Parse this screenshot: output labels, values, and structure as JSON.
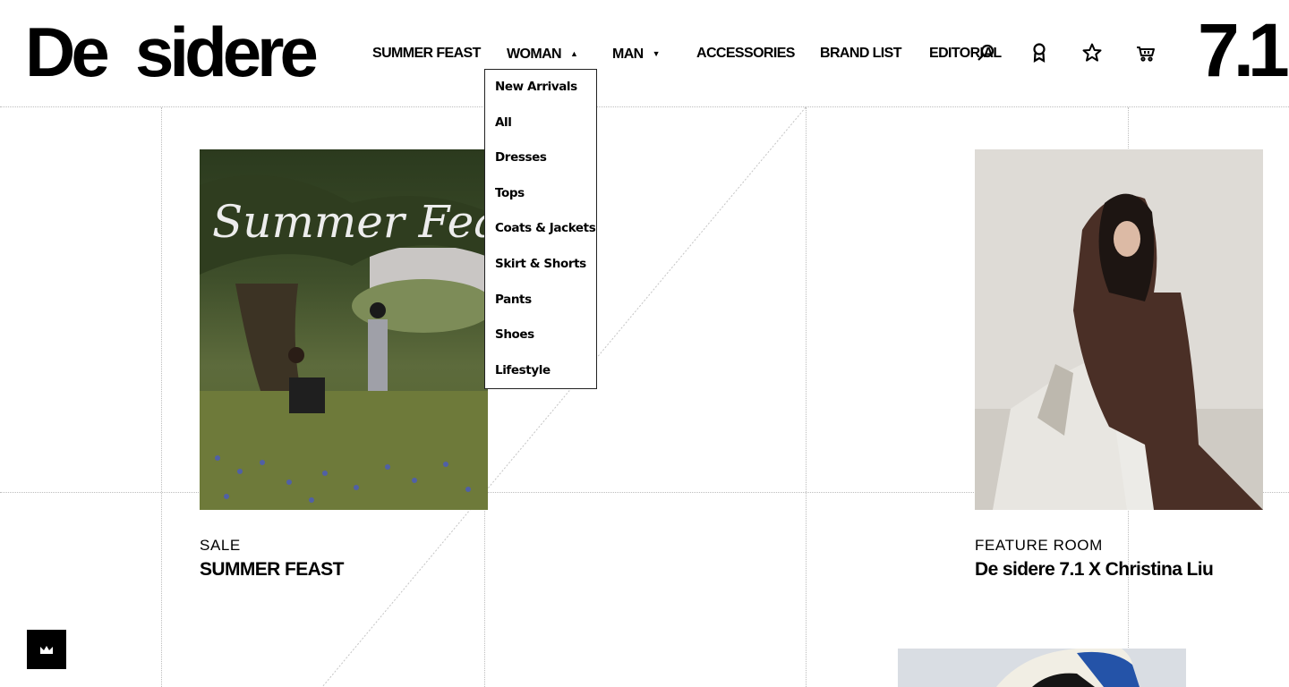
{
  "brand": {
    "logo_text": "De  sidere",
    "mark_text": "7.1"
  },
  "nav": {
    "items": [
      {
        "label": "SUMMER FEAST"
      },
      {
        "label": "WOMAN"
      },
      {
        "label": "MAN"
      },
      {
        "label": "ACCESSORIES"
      },
      {
        "label": "BRAND LIST"
      },
      {
        "label": "EDITORIAL"
      }
    ],
    "icons": [
      "search-icon",
      "account-icon",
      "favorites-star-icon",
      "cart-icon"
    ]
  },
  "woman_dropdown": {
    "items": [
      "New Arrivals",
      "All",
      "Dresses",
      "Tops",
      "Coats & Jackets",
      "Skirt & Shorts",
      "Pants",
      "Shoes",
      "Lifestyle"
    ]
  },
  "cards": [
    {
      "kicker": "SALE",
      "title": "SUMMER FEAST",
      "image_text": "Summer Feast"
    },
    {
      "kicker": "FEATURE ROOM",
      "title": "De sidere 7.1 X Christina Liu"
    }
  ],
  "floating_button": {
    "icon": "crown-icon"
  }
}
